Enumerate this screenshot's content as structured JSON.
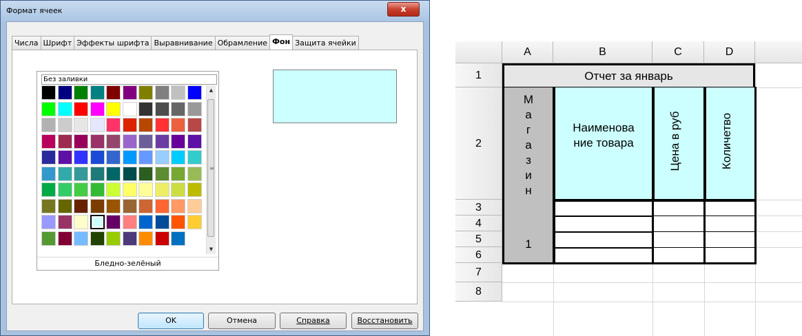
{
  "dialog": {
    "title": "Формат ячеек",
    "close_glyph": "x",
    "tabs": [
      "Числа",
      "Шрифт",
      "Эффекты шрифта",
      "Выравнивание",
      "Обрамление",
      "Фон",
      "Защита ячейки"
    ],
    "active_tab": "Фон",
    "no_fill_label": "Без заливки",
    "selected_color_name": "Бледно-зелёный",
    "preview_color": "#ccffff",
    "palette": [
      "#000000",
      "#000080",
      "#008000",
      "#008080",
      "#800000",
      "#800080",
      "#808000",
      "#808080",
      "#c0c0c0",
      "#0000ff",
      "#00ff00",
      "#00ffff",
      "#ff0000",
      "#ff00ff",
      "#ffff00",
      "#ffffff",
      "#333333",
      "#4d4d4d",
      "#666666",
      "#999999",
      "#b2b2b2",
      "#cccccc",
      "#e6e6e6",
      "#e6e6ff",
      "#ff3366",
      "#dc2300",
      "#b84700",
      "#ff3333",
      "#eb613d",
      "#b84747",
      "#b8005c",
      "#9e2a4f",
      "#99005c",
      "#993366",
      "#94476b",
      "#9966cc",
      "#6b5e9b",
      "#6b3da3",
      "#660099",
      "#5e11a6",
      "#2a2a9e",
      "#5e11a6",
      "#3333ff",
      "#1a4bd6",
      "#3366cc",
      "#0099ff",
      "#6699ff",
      "#99ccff",
      "#00ccff",
      "#33cccc",
      "#3399cc",
      "#33aaaa",
      "#339999",
      "#1f7a7a",
      "#006666",
      "#004d4d",
      "#2c5e1f",
      "#5e8c31",
      "#77a832",
      "#99bb55",
      "#00aa44",
      "#33cc66",
      "#44cc44",
      "#33bb33",
      "#ccff33",
      "#ffff66",
      "#ffff99",
      "#eeee66",
      "#ccdd44",
      "#bbbb00",
      "#777722",
      "#666600",
      "#662200",
      "#7b3d00",
      "#995500",
      "#996633",
      "#cc6633",
      "#ff6633",
      "#ff9966",
      "#ffcc99",
      "#9999ff",
      "#993366",
      "#ffffcc",
      "#ccffff",
      "#660066",
      "#ff8080",
      "#0066cc",
      "#004c99",
      "#ff5500",
      "#ffcc33",
      "#559933",
      "#800033",
      "#77bbff",
      "#224400",
      "#99cc00",
      "#4d3a7a",
      "#ff8c00",
      "#cc0000",
      "#0070c0"
    ],
    "selected_index": 83,
    "buttons": {
      "ok": "OK",
      "cancel": "Отмена",
      "help": "Справка",
      "reset": "Восстановить"
    }
  },
  "sheet": {
    "columns": [
      "A",
      "B",
      "C",
      "D"
    ],
    "rows": [
      "1",
      "2",
      "3",
      "4",
      "5",
      "6",
      "7",
      "8"
    ],
    "title": "Отчет за январь",
    "a2": [
      "М",
      "а",
      "г",
      "а",
      "з",
      "и",
      "н",
      "",
      "1"
    ],
    "b2_line1": "Наименова",
    "b2_line2": "ние товара",
    "c2": "Цена в руб",
    "d2": "Количетво",
    "colors": {
      "title_fill": "#e6e6e6",
      "shop_fill": "#c0c0c0",
      "header_fill": "#ccffff"
    }
  }
}
